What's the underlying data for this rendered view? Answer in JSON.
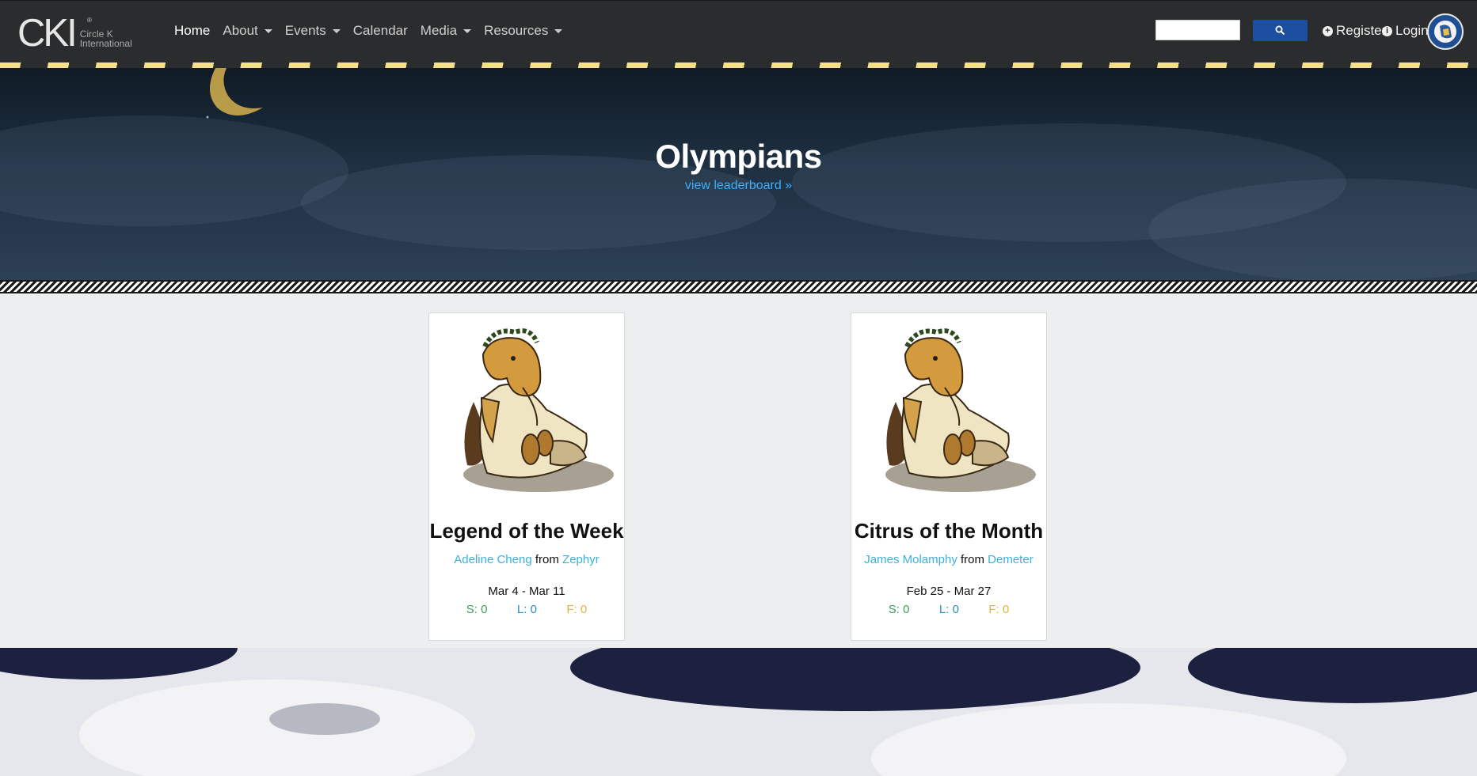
{
  "nav": {
    "logo_text": "CKI",
    "logo_sub_1": "Circle K",
    "logo_sub_2": "International",
    "items": [
      {
        "label": "Home",
        "dropdown": false
      },
      {
        "label": "About",
        "dropdown": true
      },
      {
        "label": "Events",
        "dropdown": true
      },
      {
        "label": "Calendar",
        "dropdown": false
      },
      {
        "label": "Media",
        "dropdown": true
      },
      {
        "label": "Resources",
        "dropdown": true
      }
    ],
    "search": {
      "placeholder": "",
      "value": ""
    },
    "register_label": "Register",
    "login_label": "Login",
    "colors": {
      "bar": "#2b2c2e",
      "stripe": "#f3df8c",
      "search_button": "#1c4fa1"
    }
  },
  "hero": {
    "title": "Olympians",
    "link": "view leaderboard »"
  },
  "cards": [
    {
      "title": "Legend of the Week",
      "person": "Adeline Cheng",
      "from_word": "from",
      "group": "Zephyr",
      "dates": "Mar 4 - Mar 11",
      "stats": {
        "s": "S: 0",
        "l": "L: 0",
        "f": "F: 0"
      }
    },
    {
      "title": "Citrus of the Month",
      "person": "James Molamphy",
      "from_word": "from",
      "group": "Demeter",
      "dates": "Feb 25 - Mar 27",
      "stats": {
        "s": "S: 0",
        "l": "L: 0",
        "f": "F: 0"
      }
    }
  ]
}
